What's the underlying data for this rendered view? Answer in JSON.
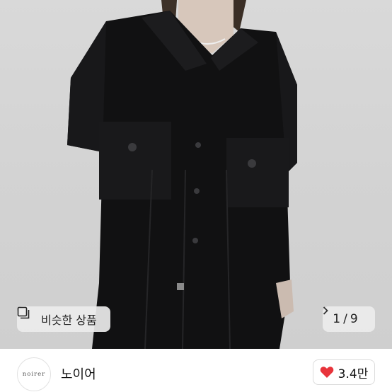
{
  "product": {
    "image_icon": "product-photo-black-short-sleeve-shirt"
  },
  "similar_button": {
    "label": "비슷한 상품",
    "icon": "similar-items-icon"
  },
  "pager": {
    "current": "1",
    "separator": "/",
    "total": "9",
    "next_icon": "chevron-right-icon"
  },
  "shop": {
    "logo_text": "noirer",
    "name": "노이어"
  },
  "like": {
    "count": "3.4만",
    "icon": "heart-icon",
    "heart_color": "#e8343b"
  }
}
